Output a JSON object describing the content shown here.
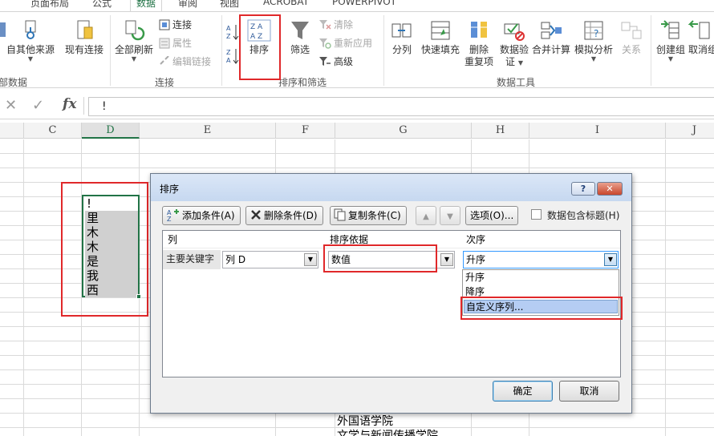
{
  "tabs": [
    "页面布局",
    "公式",
    "数据",
    "审阅",
    "视图",
    "ACROBAT",
    "POWERPIVOT"
  ],
  "active_tab": "数据",
  "ribbon": {
    "groups": {
      "get_external": "部数据",
      "connections": "连接",
      "sort_filter": "排序和筛选",
      "data_tools": "数据工具"
    },
    "buttons": {
      "other_sources": "自其他来源",
      "existing_connections": "现有连接",
      "refresh_all": "全部刷新",
      "connections": "连接",
      "properties": "属性",
      "edit_links": "编辑链接",
      "sort": "排序",
      "filter": "筛选",
      "clear": "清除",
      "reapply": "重新应用",
      "advanced": "高级",
      "text_to_columns": "分列",
      "flash_fill": "快速填充",
      "remove_dup_line1": "删除",
      "remove_dup_line2": "重复项",
      "data_validation_line1": "数据验",
      "data_validation_line2": "证",
      "consolidate": "合并计算",
      "what_if": "模拟分析",
      "relationships": "关系",
      "group": "创建组",
      "ungroup": "取消组"
    }
  },
  "formula_bar": {
    "fx_label": "fx",
    "value": "!"
  },
  "columns": [
    "C",
    "D",
    "E",
    "F",
    "G",
    "H",
    "I",
    "J"
  ],
  "selected_column": "D",
  "cells": [
    "!",
    "里",
    "木",
    "木",
    "是",
    "我",
    "西"
  ],
  "below_cells": [
    "外国语学院",
    "文学与新闻传播学院"
  ],
  "dialog": {
    "title": "排序",
    "help": "?",
    "close": "✕",
    "add_level": "添加条件(A)",
    "delete_level": "删除条件(D)",
    "copy_level": "复制条件(C)",
    "options": "选项(O)...",
    "headers_checkbox": "数据包含标题(H)",
    "headers_checked": false,
    "col_header": "列",
    "sort_on_header": "排序依据",
    "order_header": "次序",
    "primary_key_label": "主要关键字",
    "column_value": "列 D",
    "sort_on_value": "数值",
    "order_value": "升序",
    "order_options": [
      "升序",
      "降序",
      "自定义序列..."
    ],
    "highlighted_option": "自定义序列...",
    "ok": "确定",
    "cancel": "取消"
  },
  "colors": {
    "accent": "#217346",
    "annotation_red": "#e0282a",
    "selection_blue": "#b5cdf3"
  }
}
